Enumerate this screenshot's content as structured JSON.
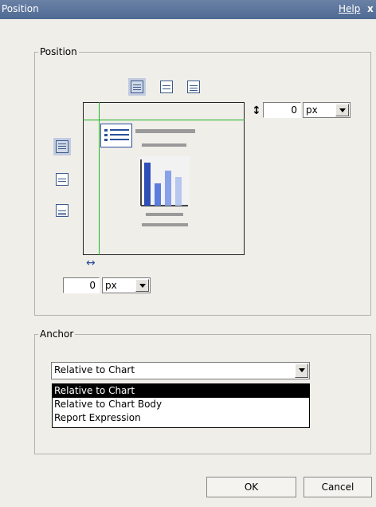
{
  "titlebar": {
    "title": "Position",
    "help": "Help",
    "close": "x"
  },
  "position_group": {
    "legend": "Position",
    "vertical_offset": {
      "value": "0",
      "unit": "px"
    },
    "horizontal_offset": {
      "value": "0",
      "unit": "px"
    },
    "vertical_arrow": "↕",
    "horizontal_arrow": "↔"
  },
  "anchor_group": {
    "legend": "Anchor",
    "selected": "Relative to Chart",
    "options": [
      "Relative to Chart",
      "Relative to Chart Body",
      "Report Expression"
    ]
  },
  "buttons": {
    "ok": "OK",
    "cancel": "Cancel"
  },
  "colors": {
    "titlebar": "#4e6a94",
    "guide_line": "#1eb51e",
    "chart_bars": "#4a6fd6",
    "selected_option": "#000000"
  }
}
